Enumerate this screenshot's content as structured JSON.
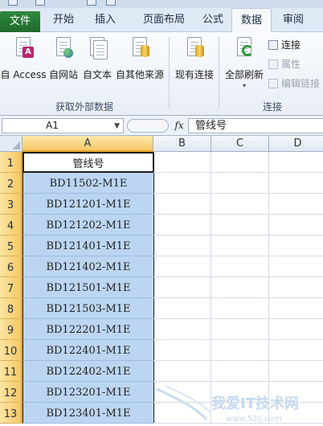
{
  "ribbon_tabs": [
    "文件",
    "开始",
    "插入",
    "页面布局",
    "公式",
    "数据",
    "审阅"
  ],
  "active_tab": "数据",
  "get_external_data": {
    "buttons": [
      "自 Access",
      "自网站",
      "自文本",
      "自其他来源"
    ],
    "group_label": "获取外部数据"
  },
  "existing_connections_label": "现有连接",
  "connections": {
    "refresh_all_label": "全部刷新",
    "connections_label": "连接",
    "properties_label": "属性",
    "edit_links_label": "编辑链接",
    "group_label": "连接"
  },
  "formula_bar": {
    "name_box": "A1",
    "fx_label": "fx",
    "formula": "管线号"
  },
  "sheet": {
    "columns": [
      "A",
      "B",
      "C",
      "D"
    ],
    "rows": [
      "1",
      "2",
      "3",
      "4",
      "5",
      "6",
      "7",
      "8",
      "9",
      "10",
      "11",
      "12",
      "13"
    ],
    "header_cell": "管线号",
    "pipe_numbers": [
      "BD11502-M1E",
      "BD121201-M1E",
      "BD121202-M1E",
      "BD121401-M1E",
      "BD121402-M1E",
      "BD121501-M1E",
      "BD121503-M1E",
      "BD122201-M1E",
      "BD122401-M1E",
      "BD122402-M1E",
      "BD123201-M1E",
      "BD123401-M1E"
    ]
  },
  "watermark": {
    "text": "我爱IT技术网",
    "url": "www.52ij.com"
  },
  "colors": {
    "file_tab": "#2f8a3c",
    "selection_fill": "#bcd6f2",
    "header_highlight": "#f6c766"
  }
}
